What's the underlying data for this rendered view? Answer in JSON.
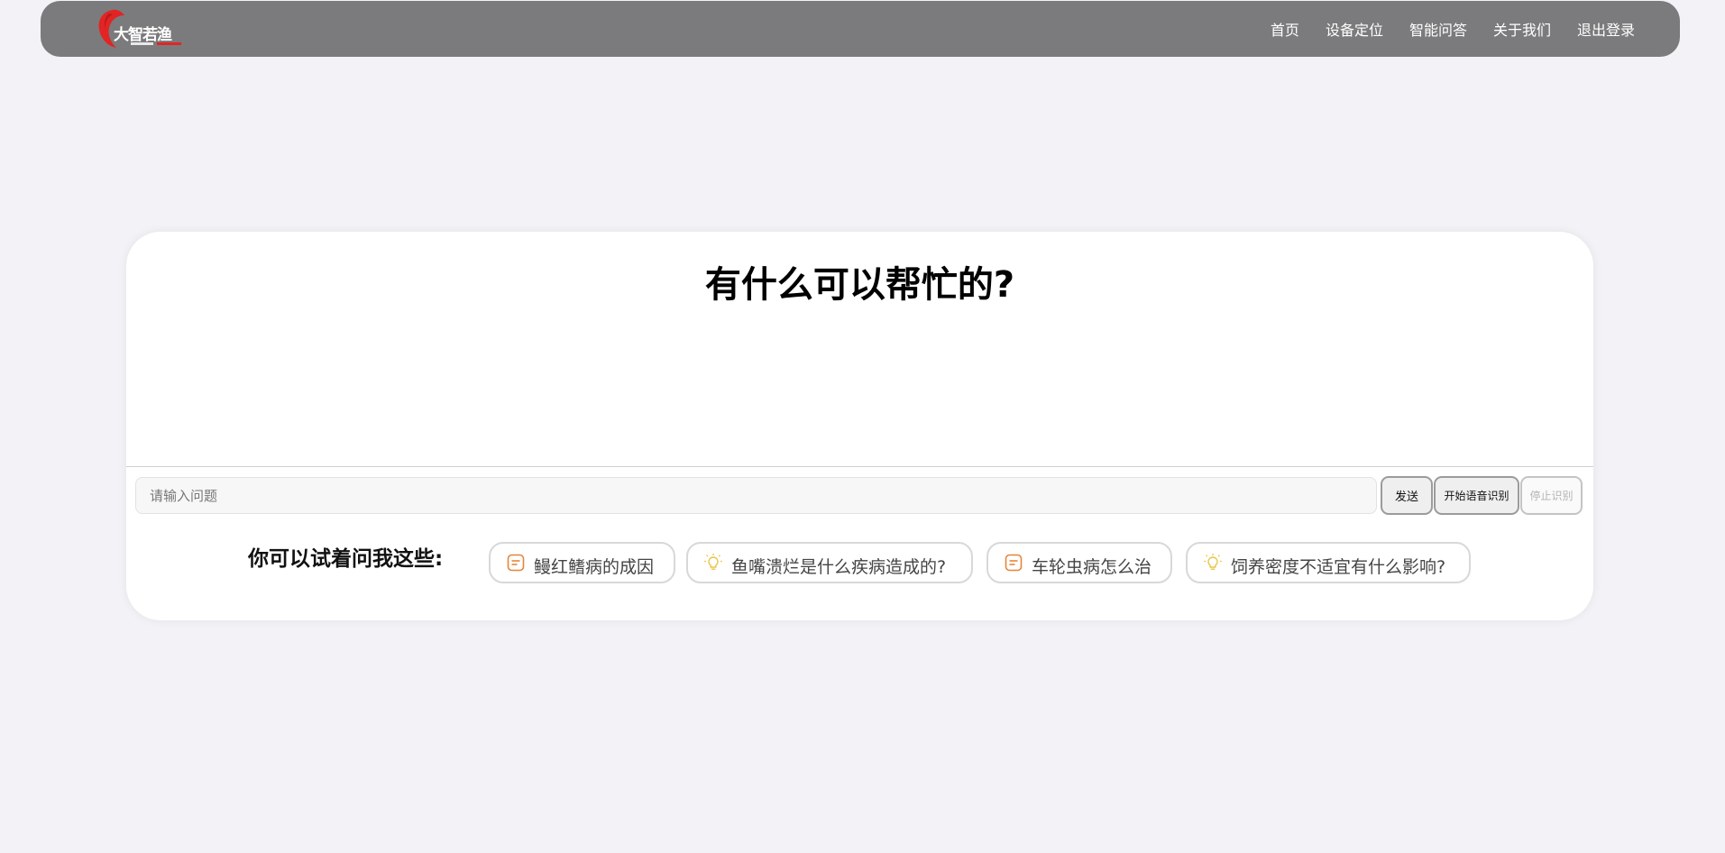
{
  "nav": {
    "logo_text": "大智若渔",
    "links": [
      "首页",
      "设备定位",
      "智能问答",
      "关于我们",
      "退出登录"
    ]
  },
  "main": {
    "title": "有什么可以帮忙的?",
    "input_placeholder": "请输入问题",
    "send_label": "发送",
    "voice_start_label": "开始语音识别",
    "voice_stop_label": "停止识别",
    "suggest_label": "你可以试着问我这些:",
    "suggestions": [
      {
        "text": "鳗红鳍病的成因",
        "icon": "note-icon"
      },
      {
        "text": "鱼嘴溃烂是什么疾病造成的?",
        "icon": "lightbulb-icon"
      },
      {
        "text": "车轮虫病怎么治",
        "icon": "note-icon"
      },
      {
        "text": "饲养密度不适宜有什么影响?",
        "icon": "lightbulb-icon"
      }
    ]
  },
  "colors": {
    "navbar": "#7b7b7d",
    "background": "#f3f3f7",
    "logo_red": "#e22424",
    "note_icon": "#e6853a",
    "bulb_icon": "#e8c545"
  }
}
